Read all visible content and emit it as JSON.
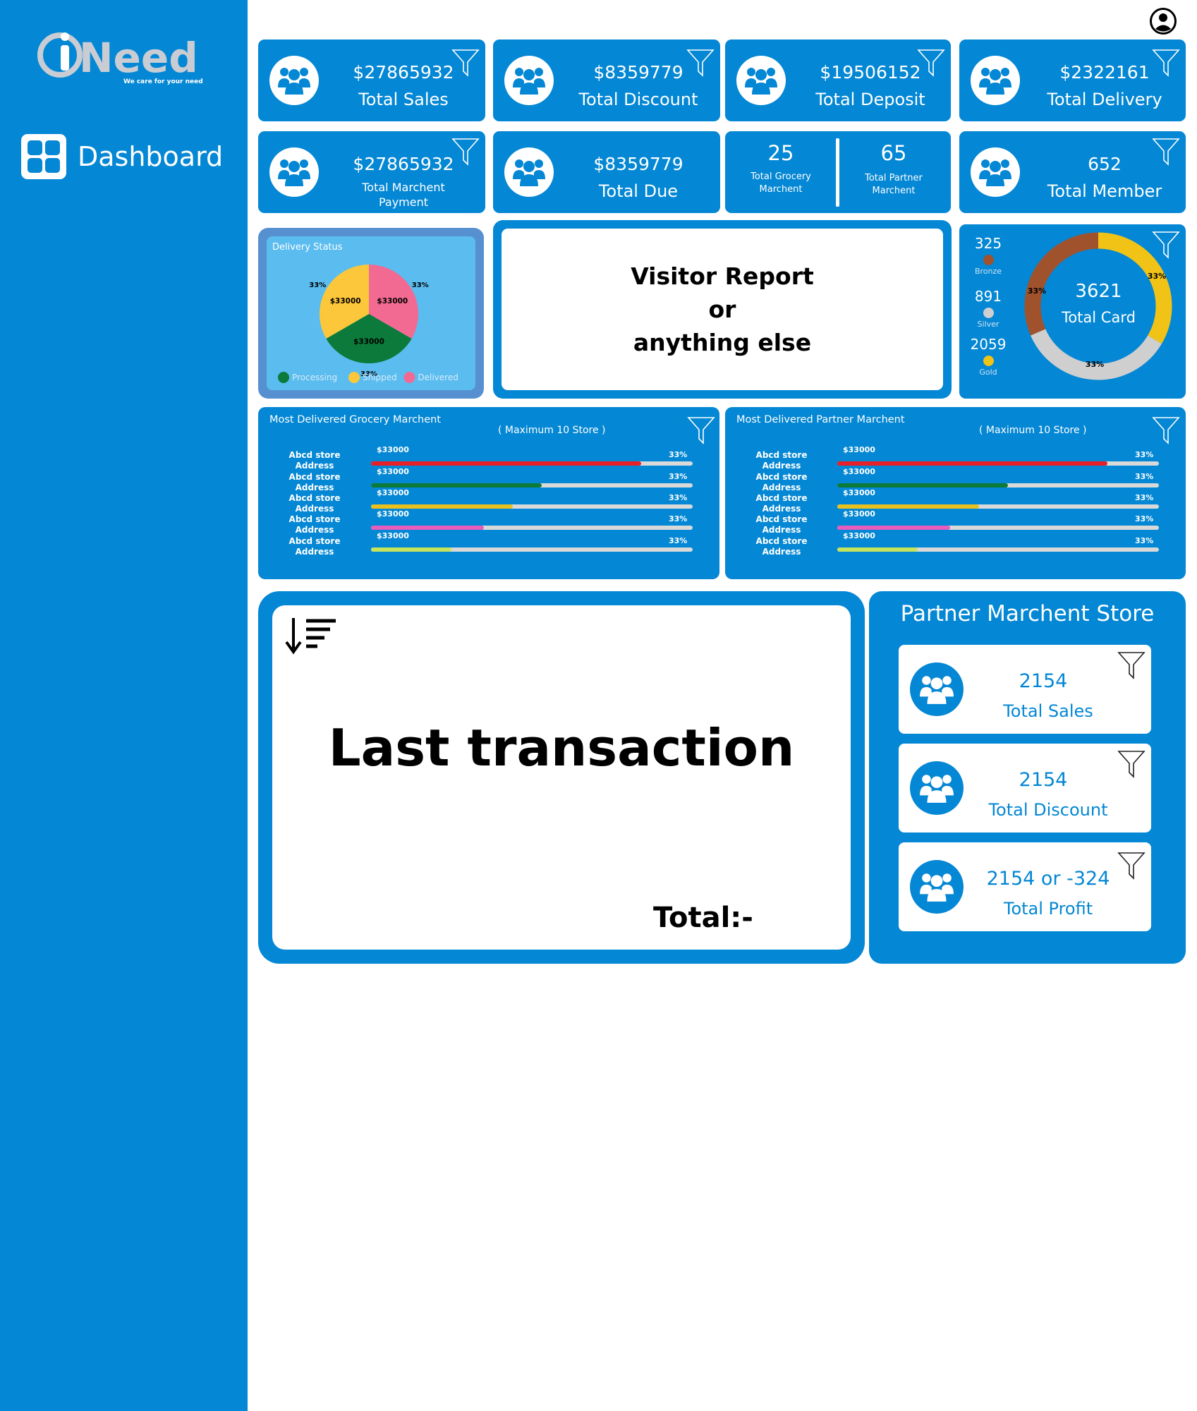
{
  "brand": {
    "name": "iNeed",
    "tagline": "We care for your need",
    "color": "#0487d4"
  },
  "nav": {
    "items": [
      {
        "label": "Dashboard",
        "icon": "dashboard-grid-icon"
      }
    ]
  },
  "header": {
    "profile_icon": "user-circle-icon"
  },
  "stats_row1": [
    {
      "value": "$27865932",
      "label": "Total Sales"
    },
    {
      "value": "$8359779",
      "label": "Total Discount"
    },
    {
      "value": "$19506152",
      "label": "Total Deposit"
    },
    {
      "value": "$2322161",
      "label": "Total Delivery"
    }
  ],
  "stats_row2": {
    "merchant_payment": {
      "value": "$27865932",
      "label_line1": "Total Marchent",
      "label_line2": "Payment"
    },
    "due": {
      "value": "$8359779",
      "label": "Total Due"
    },
    "grocery": {
      "value": "25",
      "label_line1": "Total Grocery",
      "label_line2": "Marchent"
    },
    "partner": {
      "value": "65",
      "label_line1": "Total Partner",
      "label_line2": "Marchent"
    },
    "member": {
      "value": "652",
      "label": "Total Member"
    }
  },
  "delivery_status": {
    "title": "Delivery Status",
    "legend": [
      "Processing",
      "Shipped",
      "Delivered"
    ]
  },
  "visitor": {
    "line1": "Visitor Report",
    "line2": "or",
    "line3": "anything else"
  },
  "cards": {
    "bronze": {
      "value": "325",
      "label": "Bronze"
    },
    "silver": {
      "value": "891",
      "label": "Silver"
    },
    "gold": {
      "value": "2059",
      "label": "Gold"
    },
    "total_value": "3621",
    "total_label": "Total Card"
  },
  "grocery_list": {
    "title": "Most Delivered Grocery Marchent",
    "subtitle": "( Maximum 10 Store )"
  },
  "partner_list": {
    "title": "Most Delivered Partner Marchent",
    "subtitle": "( Maximum 10 Store )"
  },
  "store_rows": [
    {
      "name": "Abcd store",
      "address": "Address",
      "amount": "$33000",
      "pct": "33%"
    },
    {
      "name": "Abcd store",
      "address": "Address",
      "amount": "$33000",
      "pct": "33%"
    },
    {
      "name": "Abcd store",
      "address": "Address",
      "amount": "$33000",
      "pct": "33%"
    },
    {
      "name": "Abcd store",
      "address": "Address",
      "amount": "$33000",
      "pct": "33%"
    },
    {
      "name": "Abcd store",
      "address": "Address",
      "amount": "$33000",
      "pct": "33%"
    }
  ],
  "transactions": {
    "title": "Last transaction",
    "total_label": "Total:-"
  },
  "partner_store": {
    "title": "Partner Marchent Store",
    "items": [
      {
        "value": "2154",
        "label": "Total Sales"
      },
      {
        "value": "2154",
        "label": "Total Discount"
      },
      {
        "value": "2154 or -324",
        "label": "Total Profit"
      }
    ]
  },
  "chart_data": [
    {
      "type": "pie",
      "title": "Delivery Status",
      "slices": [
        {
          "name": "Delivered",
          "value": 33000,
          "pct": "33%",
          "color": "#f26a92"
        },
        {
          "name": "Processing",
          "value": 33000,
          "pct": "33%",
          "color": "#0b7a3a"
        },
        {
          "name": "Shipped",
          "value": 33000,
          "pct": "33%",
          "color": "#fcc73a"
        }
      ],
      "legend": [
        "Processing",
        "Shipped",
        "Delivered"
      ]
    },
    {
      "type": "pie",
      "title": "Total Card",
      "center_value": "3621",
      "slices": [
        {
          "name": "Gold",
          "pct": "33%",
          "color": "#f1c316"
        },
        {
          "name": "Silver",
          "pct": "33%",
          "color": "#cfcfcf"
        },
        {
          "name": "Bronze",
          "pct": "33%",
          "color": "#a0522d"
        }
      ]
    },
    {
      "type": "bar",
      "title": "Most Delivered Grocery Marchent",
      "categories": [
        "Abcd store",
        "Abcd store",
        "Abcd store",
        "Abcd store",
        "Abcd store"
      ],
      "labels": [
        "$33000",
        "$33000",
        "$33000",
        "$33000",
        "$33000"
      ],
      "values": [
        0.84,
        0.53,
        0.44,
        0.35,
        0.25
      ],
      "colors": [
        "#e81f28",
        "#0b7a3a",
        "#e8c11e",
        "#e65dbd",
        "#c6e35c"
      ]
    },
    {
      "type": "bar",
      "title": "Most Delivered Partner Marchent",
      "categories": [
        "Abcd store",
        "Abcd store",
        "Abcd store",
        "Abcd store",
        "Abcd store"
      ],
      "labels": [
        "$33000",
        "$33000",
        "$33000",
        "$33000",
        "$33000"
      ],
      "values": [
        0.84,
        0.53,
        0.44,
        0.35,
        0.25
      ],
      "colors": [
        "#e81f28",
        "#0b7a3a",
        "#e8c11e",
        "#e65dbd",
        "#c6e35c"
      ]
    }
  ]
}
